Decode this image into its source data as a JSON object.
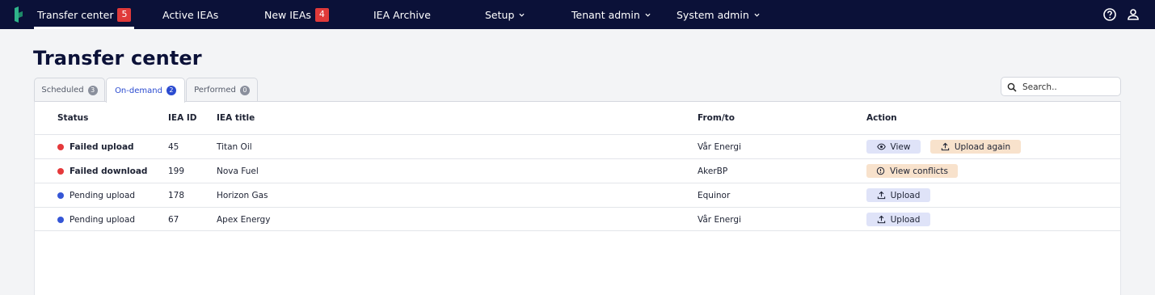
{
  "nav": {
    "items": [
      {
        "label": "Transfer center",
        "badge": "5"
      },
      {
        "label": "Active IEAs"
      },
      {
        "label": "New IEAs",
        "badge": "4"
      },
      {
        "label": "IEA Archive"
      },
      {
        "label": "Setup"
      },
      {
        "label": "Tenant admin"
      },
      {
        "label": "System admin"
      }
    ],
    "icons": [
      "help-icon",
      "user-icon"
    ]
  },
  "page": {
    "title": "Transfer center"
  },
  "tabs": [
    {
      "label": "Scheduled",
      "count": "3"
    },
    {
      "label": "On-demand",
      "count": "2",
      "active": true
    },
    {
      "label": "Performed",
      "count": "0"
    }
  ],
  "search": {
    "placeholder": "Search.."
  },
  "table": {
    "headers": {
      "status": "Status",
      "id": "IEA ID",
      "title": "IEA title",
      "fromto": "From/to",
      "action": "Action"
    },
    "rows": [
      {
        "status": "Failed upload",
        "status_color": "#e5393b",
        "id": "45",
        "title": "Titan Oil",
        "fromto": "Vår Energi",
        "actions": [
          "View",
          "Upload again"
        ]
      },
      {
        "status": "Failed download",
        "status_color": "#e5393b",
        "id": "199",
        "title": "Nova Fuel",
        "fromto": "AkerBP",
        "actions": [
          "View conflicts"
        ]
      },
      {
        "status": "Pending upload",
        "status_color": "#3556d6",
        "id": "178",
        "title": "Horizon Gas",
        "fromto": "Equinor",
        "actions": [
          "Upload"
        ]
      },
      {
        "status": "Pending upload",
        "status_color": "#3556d6",
        "id": "67",
        "title": "Apex Energy",
        "fromto": "Vår Energi",
        "actions": [
          "Upload"
        ]
      }
    ]
  },
  "colors": {
    "nav_bg": "#0b1138",
    "badge": "#e03a3a",
    "accent": "#2b4bd0",
    "btn_blue": "#dfe3f8",
    "btn_orange": "#f8e2cc"
  }
}
